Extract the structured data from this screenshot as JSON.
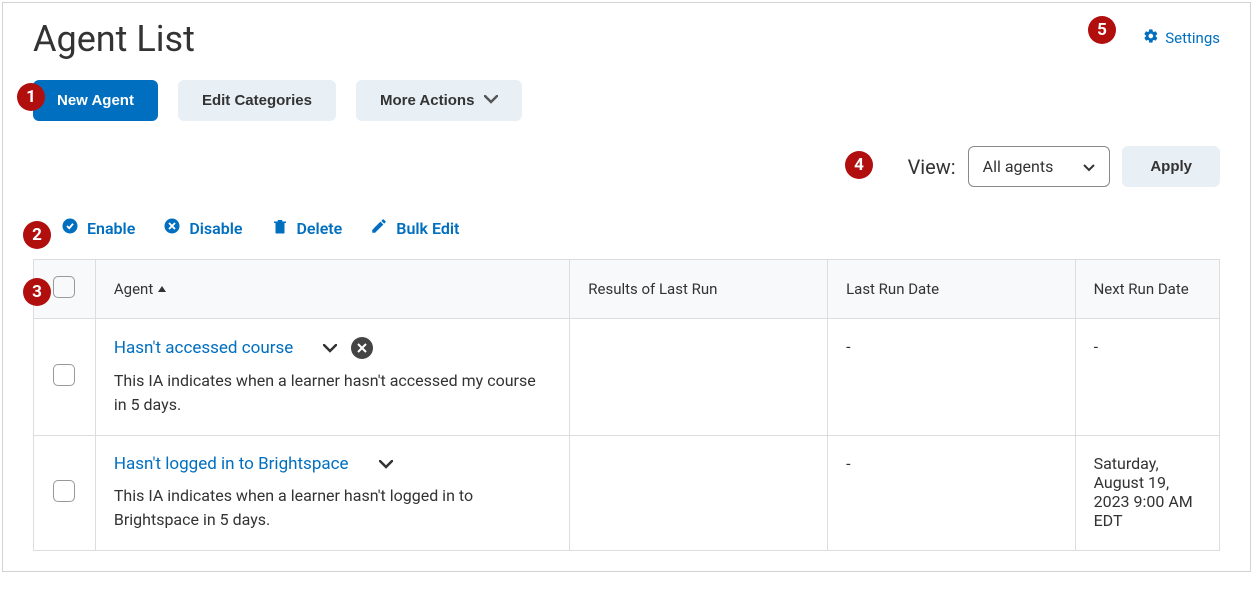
{
  "page_title": "Agent List",
  "settings_label": "Settings",
  "toolbar": {
    "new_agent": "New Agent",
    "edit_categories": "Edit Categories",
    "more_actions": "More Actions"
  },
  "view": {
    "label": "View:",
    "selected": "All agents",
    "apply": "Apply"
  },
  "actions": {
    "enable": "Enable",
    "disable": "Disable",
    "delete": "Delete",
    "bulk_edit": "Bulk Edit"
  },
  "table": {
    "headers": {
      "agent": "Agent",
      "results": "Results of Last Run",
      "last_run": "Last Run Date",
      "next_run": "Next Run Date"
    },
    "rows": [
      {
        "name": "Hasn't accessed course",
        "description": "This IA indicates when a learner hasn't accessed my course in 5 days.",
        "disabled": true,
        "results": "",
        "last_run": "-",
        "next_run": "-"
      },
      {
        "name": "Hasn't logged in to Brightspace",
        "description": "This IA indicates when a learner hasn't logged in to Brightspace in 5 days.",
        "disabled": false,
        "results": "",
        "last_run": "-",
        "next_run": "Saturday, August 19, 2023 9:00 AM EDT"
      }
    ]
  },
  "badges": [
    "1",
    "2",
    "3",
    "4",
    "5"
  ]
}
